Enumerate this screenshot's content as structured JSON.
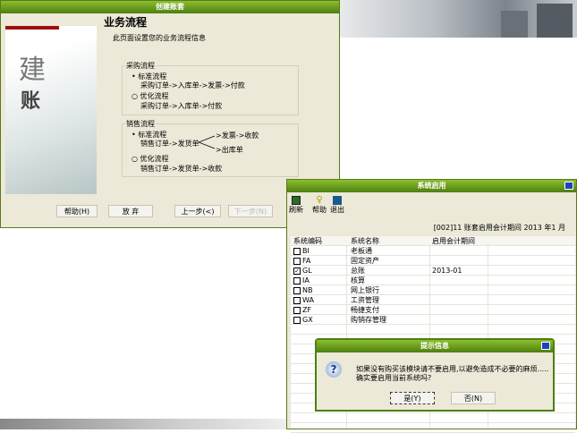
{
  "wizard": {
    "title": "创建账套",
    "heading": "业务流程",
    "subtitle": "此页面设置您的业务流程信息",
    "side_chars": [
      "建",
      "账"
    ],
    "purchase": {
      "label": "采购流程",
      "opt1": "标准流程",
      "opt1_desc": "采购订单->入库单->发票->付款",
      "opt2": "优化流程",
      "opt2_desc": "采购订单->入库单->付款"
    },
    "sales": {
      "label": "销售流程",
      "opt1": "标准流程",
      "opt1_desc": "销售订单->发货单",
      "branch1": ">发票->收款",
      "branch2": ">出库单",
      "opt2": "优化流程",
      "opt2_desc": "销售订单->发货单->收款"
    },
    "buttons": {
      "help": "帮助(H)",
      "abandon": "放 弃",
      "prev": "上一步(<)",
      "next": "下一步(N)"
    }
  },
  "sys": {
    "title": "系统启用",
    "toolbar": {
      "refresh": "刷新",
      "help": "帮助",
      "exit": "退出"
    },
    "period": "[002]11 账套启用会计期间 2013 年1 月",
    "columns": [
      "系统编码",
      "系统名称",
      "启用会计期间"
    ],
    "rows": [
      {
        "code": "BI",
        "name": "老板通",
        "period": "",
        "checked": false
      },
      {
        "code": "FA",
        "name": "固定资产",
        "period": "",
        "checked": false
      },
      {
        "code": "GL",
        "name": "总账",
        "period": "2013-01",
        "checked": true
      },
      {
        "code": "IA",
        "name": "核算",
        "period": "",
        "checked": false
      },
      {
        "code": "NB",
        "name": "网上银行",
        "period": "",
        "checked": false
      },
      {
        "code": "WA",
        "name": "工资管理",
        "period": "",
        "checked": false
      },
      {
        "code": "ZF",
        "name": "畅捷支付",
        "period": "",
        "checked": false
      },
      {
        "code": "GX",
        "name": "购销存管理",
        "period": "",
        "checked": false
      }
    ]
  },
  "msg": {
    "title": "提示信息",
    "line1": "如果没有购买该模块请不要启用,以避免造成不必要的麻烦.....",
    "line2": "确实要启用当前系统吗?",
    "yes": "是(Y)",
    "no": "否(N)"
  }
}
